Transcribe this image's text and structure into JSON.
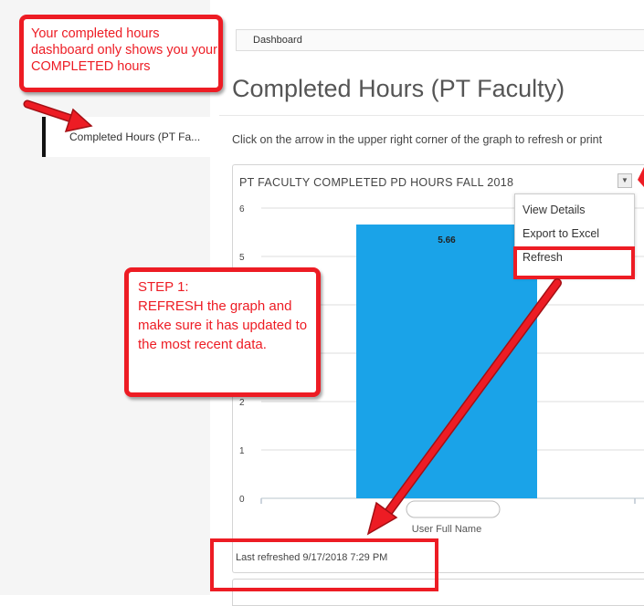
{
  "breadcrumb": {
    "label": "Dashboard"
  },
  "sidebar": {
    "items": [
      {
        "label": "Completed Hours (PT Fa..."
      }
    ]
  },
  "page": {
    "title": "Completed Hours (PT Faculty)",
    "instructions": "Click on the arrow in the upper right corner of the graph to refresh or print"
  },
  "widget": {
    "title": "PT FACULTY COMPLETED PD HOURS FALL 2018",
    "menu_items": [
      "View Details",
      "Export to Excel",
      "Refresh"
    ],
    "last_refreshed": "Last refreshed 9/17/2018 7:29 PM",
    "menu_button_icon": "chevron-down-icon"
  },
  "chart_data": {
    "type": "bar",
    "categories": [
      ""
    ],
    "values": [
      5.66
    ],
    "data_labels": [
      "5.66"
    ],
    "xlabel": "User Full Name",
    "ylabel": "",
    "ylim": [
      0,
      6
    ],
    "yticks": [
      "0",
      "1",
      "2",
      "3",
      "4",
      "5",
      "6"
    ],
    "bar_color": "#1aa3e8",
    "grid": true
  },
  "annotations": {
    "callout_top": "Your completed hours dashboard only shows you your COMPLETED hours",
    "callout_step1": "STEP 1:\nREFRESH the graph and make sure it has updated to the most recent data.",
    "accent_color": "#ed1c24"
  }
}
